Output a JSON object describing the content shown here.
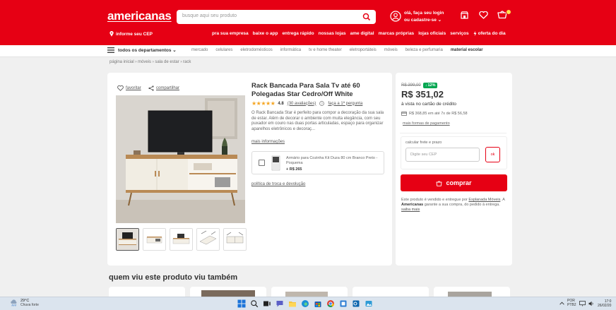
{
  "colors": {
    "brand_red": "#e60014",
    "star": "#f5a623",
    "discount_green": "#00a650"
  },
  "header": {
    "logo": "americanas",
    "search_placeholder": "busque aqui seu produto",
    "login_line1": "olá, faça seu login",
    "login_line2": "ou cadastre-se ⌄",
    "cep": "informe seu CEP",
    "top_links": [
      "pra sua empresa",
      "baixe o app",
      "entrega rápido",
      "nossas lojas",
      "ame digital",
      "marcas próprias",
      "lojas oficiais",
      "serviços",
      "oferta do dia"
    ]
  },
  "dept_bar": {
    "menu_label": "todos os departamentos ⌄",
    "categories": [
      "mercado",
      "celulares",
      "eletrodomésticos",
      "informática",
      "tv e home theater",
      "eletroportáteis",
      "móveis",
      "beleza e perfumaria",
      "material escolar"
    ]
  },
  "breadcrumb": "página inicial  ›  móveis  ›  sala de estar  ›  rack",
  "product": {
    "favorite_label": "favoritar",
    "share_label": "compartilhar",
    "title": "Rack Bancada Para Sala Tv até 60 Polegadas Star Cedro/Off White",
    "rating": "4.8",
    "rating_stars": 5,
    "reviews_label": "(30 avaliações)",
    "ask_label": "faça a 1ª pergunta",
    "description": "O Rack Bancada Star é perfeito para compor a decoração da sua sala de estar. Além de decorar o ambiente com muita elegância, com seu puxador em couro nas duas portas articuladas, espaço para organizar aparelhos eletrônicos e decoraç...",
    "more_info": "mais informações",
    "combo_item": "Armário para Cozinha Kit Duza 80 cm Branco Preto - Poquema",
    "combo_price": "+ R$ 265",
    "policy": "política de troca e devolução"
  },
  "buy_box": {
    "old_price": "R$ 399,00",
    "discount": "12%",
    "price": "R$ 351,02",
    "cash_label": "à vista no cartão de crédito",
    "installments": "R$ 368,85 em até 7x de R$ 56,58",
    "payment_ways": "mais formas de pagamento",
    "shipping_label": "calcular frete e prazo",
    "cep_placeholder": "Digite seu CEP",
    "ok_label": "ok",
    "buy_label": "comprar",
    "seller_pre": "Este produto é vendido e entregue por",
    "seller_name": "Esplanada Móveis",
    "seller_mid": ". A",
    "seller_brand": "Americanas",
    "seller_post": "garante a sua compra, do pedido à entrega.",
    "seller_more": "saiba mais"
  },
  "recommendations": {
    "title": "quem viu este produto viu também"
  },
  "taskbar": {
    "weather_temp": "29°C",
    "weather_desc": "Chuva forte",
    "lang_top": "POR",
    "lang_bottom": "PTB2",
    "time": "17:0",
    "date": "26/02/20"
  }
}
